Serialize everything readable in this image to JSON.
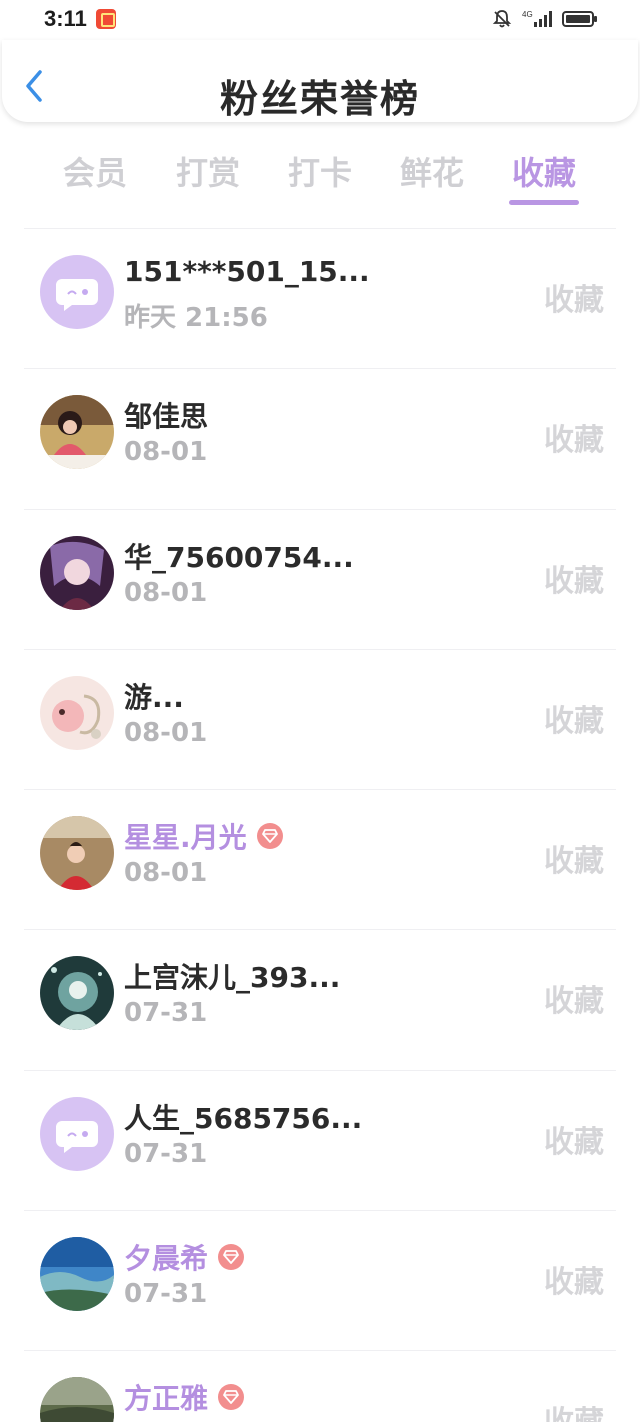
{
  "status": {
    "time": "3:11",
    "network": "4G"
  },
  "header": {
    "title": "粉丝荣誉榜"
  },
  "tabs": [
    {
      "label": "会员"
    },
    {
      "label": "打赏"
    },
    {
      "label": "打卡"
    },
    {
      "label": "鲜花"
    },
    {
      "label": "收藏"
    }
  ],
  "active_tab": "收藏",
  "colors": {
    "accent": "#b996e3",
    "vip_name": "#b48fe0",
    "badge": "#f28e8e",
    "muted": "#b5b5b8"
  },
  "fans": [
    {
      "name": "151***501_15...",
      "date": "昨天 21:56",
      "action": "收藏",
      "vip": false,
      "avatar": "default-avatar-icon"
    },
    {
      "name": "邹佳思",
      "date": "08-01",
      "action": "收藏",
      "vip": false,
      "avatar": "user-photo-avatar"
    },
    {
      "name": "华_75600754...",
      "date": "08-01",
      "action": "收藏",
      "vip": false,
      "avatar": "user-photo-avatar"
    },
    {
      "name": "游...",
      "date": "08-01",
      "action": "收藏",
      "vip": false,
      "avatar": "user-photo-avatar"
    },
    {
      "name": "星星.月光",
      "date": "08-01",
      "action": "收藏",
      "vip": true,
      "avatar": "user-photo-avatar"
    },
    {
      "name": "上宫沫儿_393...",
      "date": "07-31",
      "action": "收藏",
      "vip": false,
      "avatar": "user-photo-avatar"
    },
    {
      "name": "人生_5685756...",
      "date": "07-31",
      "action": "收藏",
      "vip": false,
      "avatar": "default-avatar-icon"
    },
    {
      "name": "夕晨希",
      "date": "07-31",
      "action": "收藏",
      "vip": true,
      "avatar": "user-photo-avatar"
    },
    {
      "name": "方正雅",
      "date": "",
      "action": "收藏",
      "vip": true,
      "avatar": "user-photo-avatar"
    }
  ]
}
